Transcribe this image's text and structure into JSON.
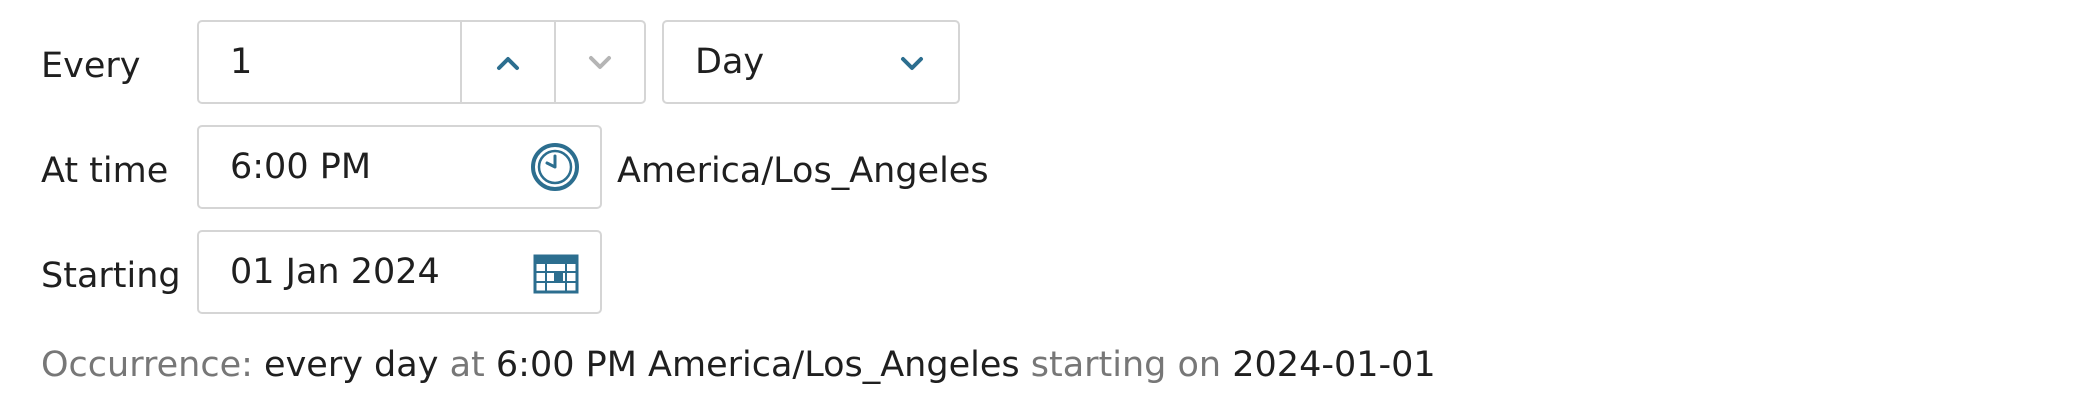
{
  "every": {
    "label": "Every",
    "value": "1",
    "unit": "Day"
  },
  "time": {
    "label": "At time",
    "value": "6:00 PM",
    "timezone": "America/Los_Angeles"
  },
  "start": {
    "label": "Starting",
    "value": "01 Jan 2024"
  },
  "summary": {
    "prefix": "Occurrence:",
    "frequency": "every day",
    "at_word": "at",
    "time": "6:00 PM America/Los_Angeles",
    "starting_word": "starting on",
    "date": "2024-01-01"
  },
  "colors": {
    "accent": "#2c6e8f",
    "disabled_icon": "#b5b5b5",
    "border": "#d5d5d5",
    "muted_text": "#777777"
  },
  "icons": {
    "increment": "chevron-up-icon",
    "decrement": "chevron-down-icon",
    "unit_dropdown": "chevron-down-icon",
    "time_picker": "clock-icon",
    "date_picker": "calendar-icon"
  }
}
